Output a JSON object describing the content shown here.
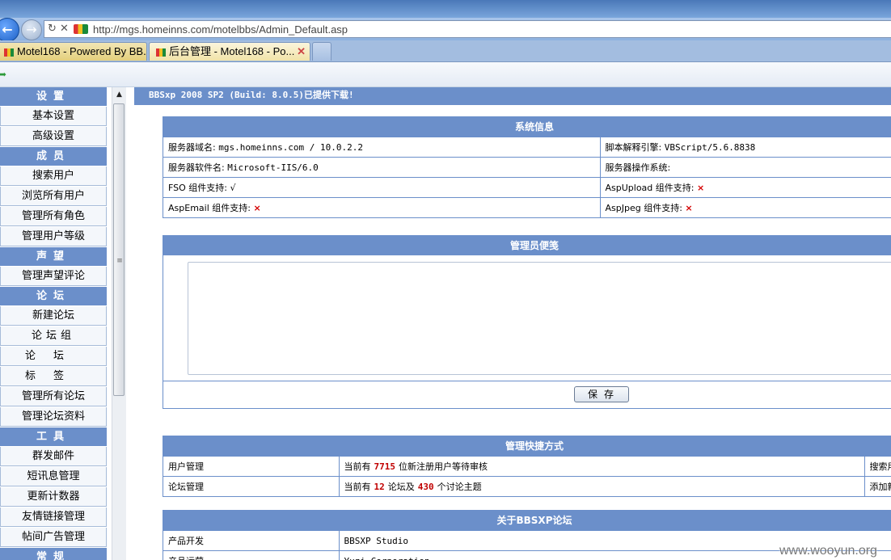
{
  "browser": {
    "url": "http://mgs.homeinns.com/motelbbs/Admin_Default.asp",
    "tabs": [
      {
        "label": "Motel168 - Powered By BB..."
      },
      {
        "label": "后台管理 - Motel168 - Po..."
      }
    ],
    "icons": {
      "back": "back-arrow-icon",
      "forward": "forward-arrow-icon",
      "reload": "reload-icon",
      "stop": "stop-icon",
      "close": "close-icon"
    }
  },
  "sidebar": {
    "sections": [
      {
        "title": "设置",
        "items": [
          "基本设置",
          "高级设置"
        ]
      },
      {
        "title": "成员",
        "items": [
          "搜索用户",
          "浏览所有用户",
          "管理所有角色",
          "管理用户等级"
        ]
      },
      {
        "title": "声望",
        "items": [
          "管理声望评论"
        ]
      },
      {
        "title": "论坛",
        "items": [
          "新建论坛",
          "论坛组",
          "论坛",
          "标签",
          "管理所有论坛",
          "管理论坛资料"
        ]
      },
      {
        "title": "工具",
        "items": [
          "群发邮件",
          "短讯息管理",
          "更新计数器",
          "友情链接管理",
          "帖间广告管理"
        ]
      },
      {
        "title": "常规",
        "items": []
      }
    ]
  },
  "announcement": "BBSxp 2008 SP2 (Build: 8.0.5)已提供下载!",
  "sysinfo": {
    "title": "系统信息",
    "rows": [
      {
        "left_label": "服务器域名:",
        "left_value": "mgs.homeinns.com / 10.0.2.2",
        "right_label": "脚本解释引擎:",
        "right_value": "VBScript/5.6.8838"
      },
      {
        "left_label": "服务器软件名:",
        "left_value": "Microsoft-IIS/6.0",
        "right_label": "服务器操作系统:",
        "right_value": ""
      },
      {
        "left_label": "FSO 组件支持:",
        "left_value": "√",
        "right_label": "AspUpload 组件支持:",
        "right_value": "×"
      },
      {
        "left_label": "AspEmail 组件支持:",
        "left_value": "×",
        "right_label": "AspJpeg 组件支持:",
        "right_value": "×"
      }
    ]
  },
  "notes": {
    "title": "管理员便笺",
    "content": "",
    "save_label": "保存"
  },
  "shortcuts": {
    "title": "管理快捷方式",
    "rows": [
      {
        "label": "用户管理",
        "prefix": "当前有",
        "count": "7715",
        "suffix": "位新注册用户等待审核",
        "extra": "搜索用"
      },
      {
        "label": "论坛管理",
        "prefix": "当前有",
        "count": "12",
        "mid": "论坛及",
        "count2": "430",
        "suffix": "个讨论主题",
        "extra": "添加新"
      }
    ]
  },
  "about": {
    "title": "关于BBSXP论坛",
    "rows": [
      {
        "label": "产品开发",
        "value": "BBSXP Studio"
      },
      {
        "label": "产品运营",
        "value": "Yuzi Corporation"
      }
    ]
  },
  "watermark": "www.wooyun.org",
  "colors": {
    "header_blue": "#6b8fca",
    "count_red": "#c00000",
    "x_red": "#d40000"
  }
}
